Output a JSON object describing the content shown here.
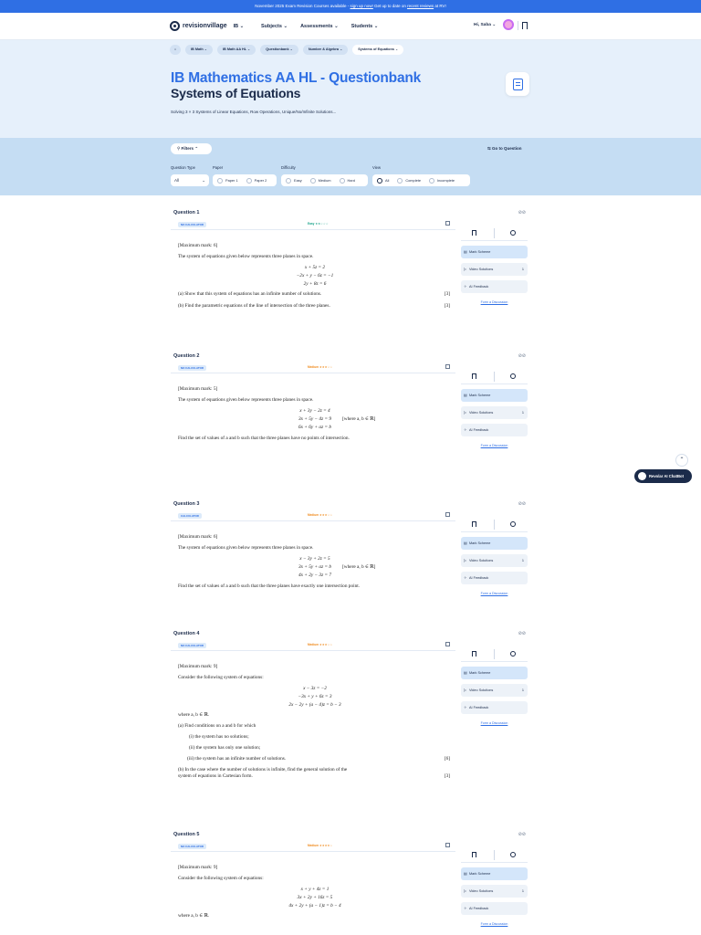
{
  "announcement": {
    "text": "November 2025 Exam Revision Courses available - ",
    "link": "sign up now!",
    "text2": " Get up to date on ",
    "link2": "recent reviews",
    "text3": " at RV!"
  },
  "nav": {
    "logo": "revisionvillage",
    "curriculum": "IB",
    "menu": [
      "Subjects",
      "Assessments",
      "Students"
    ],
    "user": "Hi, Saba"
  },
  "breadcrumbs": [
    "IB Math",
    "IB Math AA HL",
    "Questionbank",
    "Number & Algebra",
    "Systems of Equations"
  ],
  "hero": {
    "title": "IB Mathematics AA HL - Questionbank",
    "subtitle": "Systems of Equations",
    "description": "Solving 3 × 3 Systems of Linear Equations, Row Operations, Unique/No/Infinite Solutions..."
  },
  "filters": {
    "button": "Filters",
    "goto": "Go to Question",
    "labels": {
      "type": "Question Type",
      "paper": "Paper",
      "difficulty": "Difficulty",
      "view": "View"
    },
    "type_value": "All",
    "paper": [
      "Paper 1",
      "Paper 2"
    ],
    "difficulty": [
      "Easy",
      "Medium",
      "Hard"
    ],
    "view": [
      "All",
      "Complete",
      "Incomplete"
    ]
  },
  "side": {
    "mark_scheme": "Mark Scheme",
    "video": "Video Solutions",
    "video_count": "1",
    "ai": "AI Feedback",
    "report": "Form a Discussion"
  },
  "questions": [
    {
      "title": "Question 1",
      "tag": "NO CALCULATOR",
      "difficulty": "Easy",
      "diff_color": "#1aa38a",
      "max": "[Maximum mark: 6]",
      "intro": "The system of equations given below represents three planes in space.",
      "eqs": [
        "x + 5z = 2",
        "−2x + y − 6z = −1",
        "2y + 8z = 6"
      ],
      "parts": [
        {
          "text": "(a)  Show that this system of equations has an infinite number of solutions.",
          "mark": "[3]"
        },
        {
          "text": "(b)  Find the parametric equations of the line of intersection of the three planes.",
          "mark": "[3]"
        }
      ]
    },
    {
      "title": "Question 2",
      "tag": "NO CALCULATOR",
      "difficulty": "Medium",
      "diff_color": "#f08a1c",
      "max": "[Maximum mark: 5]",
      "intro": "The system of equations given below represents three planes in space.",
      "eqs": [
        "x + 3y − 2z = 4",
        "3x + 5y − 4z = 9",
        "6x + 6y + az = b"
      ],
      "eq_note": "[where a, b ∈ ℝ]",
      "tail": "Find the set of values of a and b such that the three planes have no points of intersection."
    },
    {
      "title": "Question 3",
      "tag": "CALCULATOR",
      "difficulty": "Medium",
      "diff_color": "#f08a1c",
      "max": "[Maximum mark: 6]",
      "intro": "The system of equations given below represents three planes in space.",
      "eqs": [
        "x − 3y + 2z = 5",
        "3x + 5y + az = b",
        "4x + 2y − 3z = 7"
      ],
      "eq_note": "[where a, b ∈ ℝ]",
      "tail": "Find the set of values of a and b such that the three planes have exactly one intersection point."
    },
    {
      "title": "Question 4",
      "tag": "NO CALCULATOR",
      "difficulty": "Medium",
      "diff_color": "#f08a1c",
      "max": "[Maximum mark: 9]",
      "intro": "Consider the following system of equations:",
      "eqs": [
        "x − 3z = −2",
        "−3x + y + 6z = 3",
        "2x − 2y + (a − 4)z = b − 3"
      ],
      "where": "where a, b ∈ ℝ.",
      "parta": "(a)  Find conditions on a and b for which",
      "subs": [
        "(i)  the system has no solutions;",
        "(ii)  the system has only one solution;",
        "(iii)  the system has an infinite number of solutions."
      ],
      "sub_mark": "[6]",
      "partb": "(b)  In the case where the number of solutions is infinite, find the general solution of the system of equations in Cartesian form.",
      "partb_mark": "[3]"
    },
    {
      "title": "Question 5",
      "tag": "NO CALCULATOR",
      "difficulty": "Medium",
      "diff_color": "#f08a1c",
      "max": "[Maximum mark: 9]",
      "intro": "Consider the following system of equations:",
      "eqs": [
        "x + y + 4z = 1",
        "3x + 2y + 16z = 5",
        "4x + 2y + (a − 1)z = b − 4"
      ],
      "where": "where a, b ∈ ℝ."
    }
  ],
  "chatbot": "Revolar AI ChatBot"
}
